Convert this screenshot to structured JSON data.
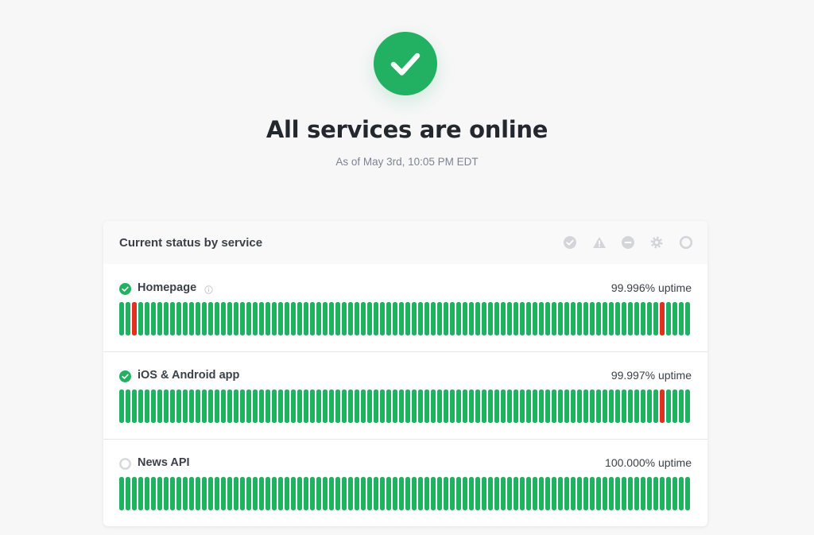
{
  "hero": {
    "status_icon": "check-circle-icon",
    "title": "All services are online",
    "subtitle": "As of May 3rd, 10:05 PM EDT"
  },
  "colors": {
    "operational": "#22b062",
    "outage": "#e0311e",
    "header_bg": "#f9f9fa",
    "legend_icon": "#d3d5da",
    "muted_status": "#d6d8dc"
  },
  "card": {
    "title": "Current status by service",
    "legend": [
      {
        "icon": "operational-icon",
        "label": "Operational"
      },
      {
        "icon": "warning-icon",
        "label": "Degraded"
      },
      {
        "icon": "outage-icon",
        "label": "Outage"
      },
      {
        "icon": "maintenance-icon",
        "label": "Maintenance"
      },
      {
        "icon": "no-data-icon",
        "label": "No data"
      }
    ]
  },
  "services": [
    {
      "name": "Homepage",
      "status": "operational",
      "has_info": true,
      "uptime": "99.996% uptime",
      "outage_days": [
        2,
        85
      ]
    },
    {
      "name": "iOS & Android app",
      "status": "operational",
      "has_info": false,
      "uptime": "99.997% uptime",
      "outage_days": [
        85
      ]
    },
    {
      "name": "News API",
      "status": "unknown",
      "has_info": false,
      "uptime": "100.000% uptime",
      "outage_days": []
    }
  ],
  "days_count": 90
}
